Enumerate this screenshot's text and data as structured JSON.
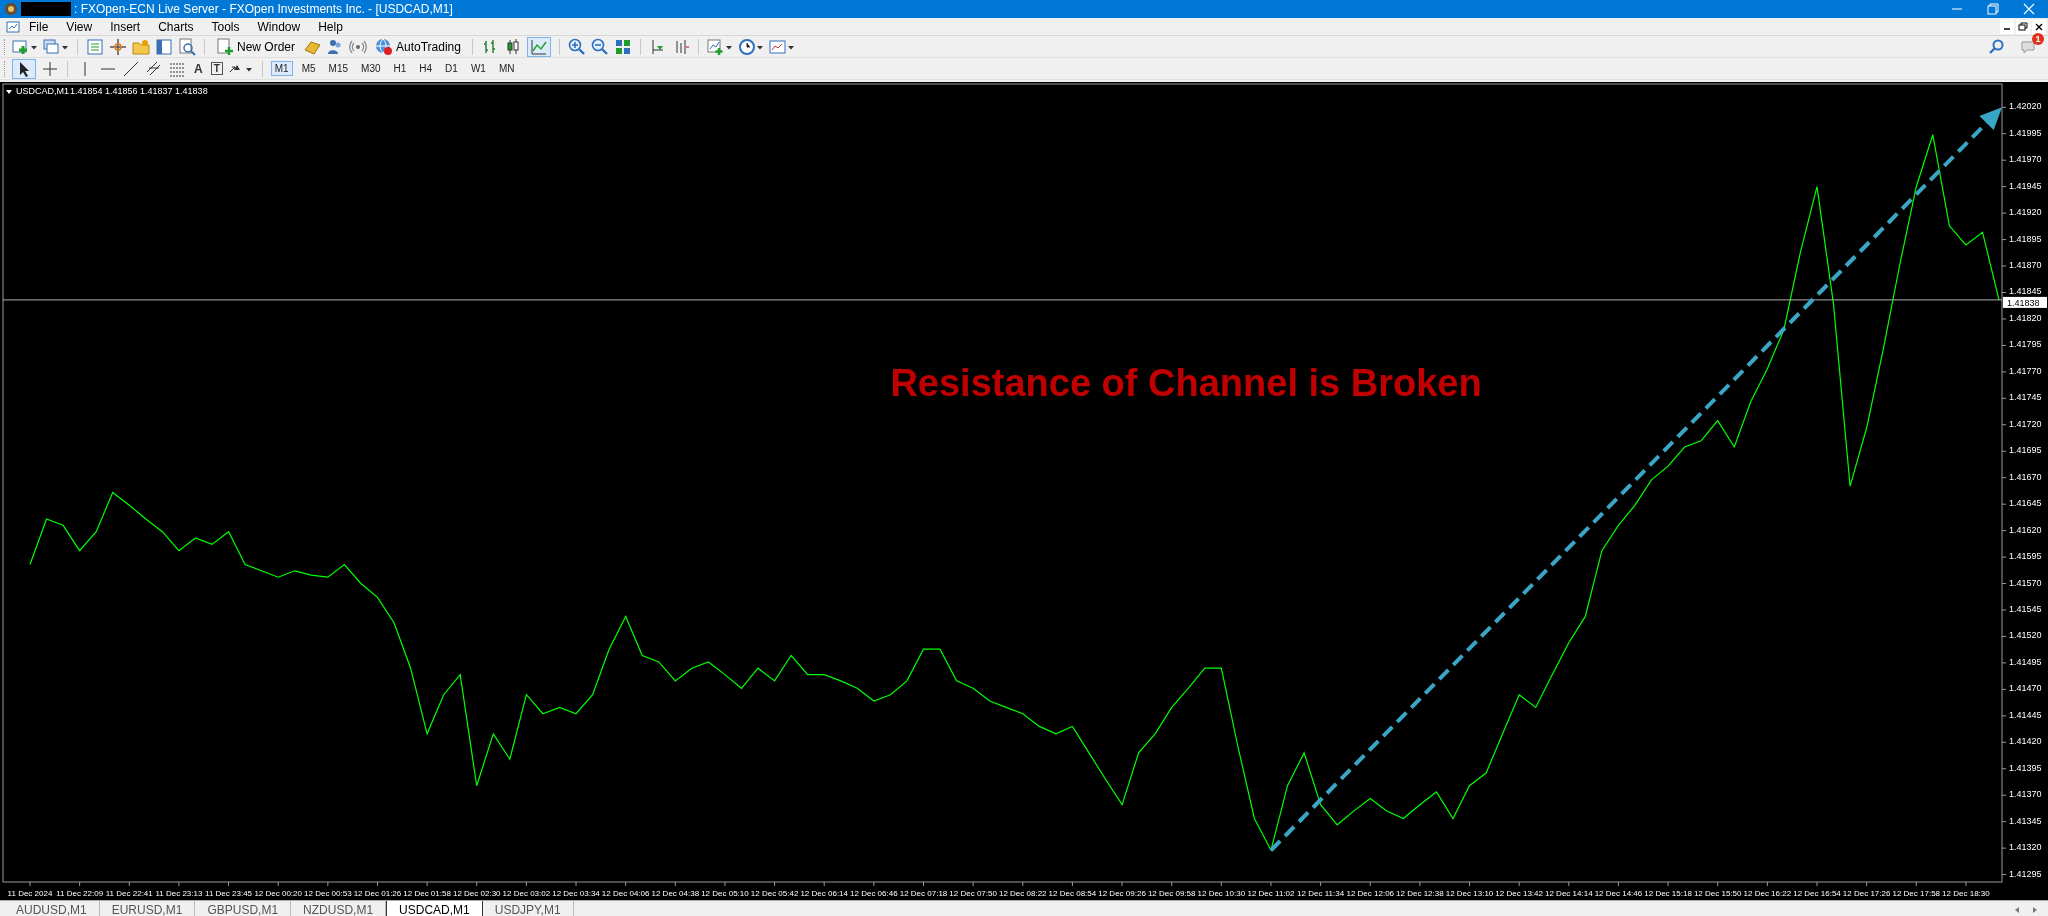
{
  "window": {
    "title": ": FXOpen-ECN Live Server - FXOpen Investments Inc. - [USDCAD,M1]"
  },
  "menu": [
    "File",
    "View",
    "Insert",
    "Charts",
    "Tools",
    "Window",
    "Help"
  ],
  "toolbar": {
    "new_order": "New Order",
    "autotrading": "AutoTrading",
    "notification_badge": "1"
  },
  "drawing_tools": {
    "text_glyph": "A",
    "label_glyph": "T"
  },
  "timeframes": [
    {
      "label": "M1",
      "selected": true
    },
    {
      "label": "M5",
      "selected": false
    },
    {
      "label": "M15",
      "selected": false
    },
    {
      "label": "M30",
      "selected": false
    },
    {
      "label": "H1",
      "selected": false
    },
    {
      "label": "H4",
      "selected": false
    },
    {
      "label": "D1",
      "selected": false
    },
    {
      "label": "W1",
      "selected": false
    },
    {
      "label": "MN",
      "selected": false
    }
  ],
  "chart": {
    "symbol": "USDCAD,M1",
    "quote": "1.41854 1.41856 1.41837 1.41838",
    "chart_data": {
      "type": "line",
      "ylim": [
        1.41288,
        1.42042
      ],
      "yticks": [
        1.41295,
        {
          "value": 1.4132,
          "label": "1.41320"
        },
        1.41345,
        {
          "value": 1.4137,
          "label": "1.41370"
        },
        1.41395,
        {
          "value": 1.4142,
          "label": "1.41420"
        },
        1.41445,
        {
          "value": 1.4147,
          "label": "1.41470"
        },
        1.41495,
        {
          "value": 1.4152,
          "label": "1.41520"
        },
        1.41545,
        {
          "value": 1.4157,
          "label": "1.41570"
        },
        1.41595,
        {
          "value": 1.4162,
          "label": "1.41620"
        },
        1.41645,
        {
          "value": 1.4167,
          "label": "1.41670"
        },
        1.41695,
        {
          "value": 1.4172,
          "label": "1.41720"
        },
        1.41745,
        {
          "value": 1.4177,
          "label": "1.41770"
        },
        1.41795,
        {
          "value": 1.4182,
          "label": "1.41820"
        },
        1.41845,
        {
          "value": 1.4187,
          "label": "1.41870"
        },
        1.41895,
        {
          "value": 1.4192,
          "label": "1.41920"
        },
        1.41945,
        {
          "value": 1.4197,
          "label": "1.41970"
        },
        1.41995,
        {
          "value": 1.4202,
          "label": "1.42020"
        }
      ],
      "categories": [
        "11 Dec 2024",
        null,
        null,
        "11 Dec 22:09",
        null,
        null,
        "11 Dec 22:41",
        null,
        null,
        "11 Dec 23:13",
        null,
        null,
        "11 Dec 23:45",
        null,
        null,
        "12 Dec 00:20",
        null,
        null,
        "12 Dec 00:53",
        null,
        null,
        "12 Dec 01:26",
        null,
        null,
        "12 Dec 01:58",
        null,
        null,
        "12 Dec 02:30",
        null,
        null,
        "12 Dec 03:02",
        null,
        null,
        "12 Dec 03:34",
        null,
        null,
        "12 Dec 04:06",
        null,
        null,
        "12 Dec 04:38",
        null,
        null,
        "12 Dec 05:10",
        null,
        null,
        "12 Dec 05:42",
        null,
        null,
        "12 Dec 06:14",
        null,
        null,
        "12 Dec 06:46",
        null,
        null,
        "12 Dec 07:18",
        null,
        null,
        "12 Dec 07:50",
        null,
        null,
        "12 Dec 08:22",
        null,
        null,
        "12 Dec 08:54",
        null,
        null,
        "12 Dec 09:26",
        null,
        null,
        "12 Dec 09:58",
        null,
        null,
        "12 Dec 10:30",
        null,
        null,
        "12 Dec 11:02",
        null,
        null,
        "12 Dec 11:34",
        null,
        null,
        "12 Dec 12:06",
        null,
        null,
        "12 Dec 12:38",
        null,
        null,
        "12 Dec 13:10",
        null,
        null,
        "12 Dec 13:42",
        null,
        null,
        "12 Dec 14:14",
        null,
        null,
        "12 Dec 14:46",
        null,
        null,
        "12 Dec 15:18",
        null,
        null,
        "12 Dec 15:50",
        null,
        null,
        "12 Dec 16:22",
        null,
        null,
        "12 Dec 16:54",
        null,
        null,
        "12 Dec 17:26",
        null,
        null,
        "12 Dec 17:58",
        null,
        null,
        "12 Dec 18:30",
        null,
        null
      ],
      "series": [
        {
          "color": "#00ff00",
          "values": [
            1.41588,
            1.41631,
            1.41625,
            1.41601,
            1.41619,
            1.41656,
            1.41644,
            1.41631,
            1.41619,
            1.41601,
            1.41613,
            1.41607,
            1.41619,
            1.41588,
            1.41582,
            1.41576,
            1.41582,
            1.41578,
            1.41576,
            1.41588,
            1.4157,
            1.41557,
            1.41533,
            1.4149,
            1.41428,
            1.41465,
            1.41484,
            1.41379,
            1.41428,
            1.41404,
            1.41465,
            1.41447,
            1.41453,
            1.41447,
            1.41465,
            1.41508,
            1.41539,
            1.41502,
            1.41496,
            1.41478,
            1.4149,
            1.41496,
            1.41484,
            1.41471,
            1.4149,
            1.41478,
            1.41502,
            1.41484,
            1.41484,
            1.41478,
            1.41471,
            1.41459,
            1.41465,
            1.41478,
            1.41508,
            1.41508,
            1.41478,
            1.41471,
            1.41459,
            1.41453,
            1.41447,
            1.41435,
            1.41428,
            1.41435,
            1.4141,
            1.41385,
            1.41361,
            1.4141,
            1.41428,
            1.41453,
            1.41471,
            1.4149,
            1.4149,
            1.41416,
            1.41348,
            1.41318,
            1.41379,
            1.4141,
            1.41361,
            1.41342,
            1.41355,
            1.41367,
            1.41355,
            1.41348,
            1.41361,
            1.41373,
            1.41348,
            1.41379,
            1.41391,
            1.41428,
            1.41465,
            1.41453,
            1.41484,
            1.41514,
            1.41539,
            1.41601,
            1.41625,
            1.41644,
            1.41668,
            1.41681,
            1.41699,
            1.41705,
            1.41724,
            1.41699,
            1.41742,
            1.41773,
            1.4181,
            1.41883,
            1.41945,
            1.41834,
            1.41662,
            1.41717,
            1.41791,
            1.41871,
            1.41945,
            1.41994,
            1.41908,
            1.4189,
            1.41902,
            1.41838
          ]
        }
      ],
      "ref_lines": [
        {
          "axis": "y",
          "value": 1.41838,
          "label": "1.41838"
        }
      ],
      "annotations": [
        "Resistance of Channel is Broken"
      ]
    }
  },
  "tabs": [
    {
      "label": "AUDUSD,M1",
      "selected": false
    },
    {
      "label": "EURUSD,M1",
      "selected": false
    },
    {
      "label": "GBPUSD,M1",
      "selected": false
    },
    {
      "label": "NZDUSD,M1",
      "selected": false
    },
    {
      "label": "USDCAD,M1",
      "selected": true
    },
    {
      "label": "USDJPY,M1",
      "selected": false
    }
  ]
}
